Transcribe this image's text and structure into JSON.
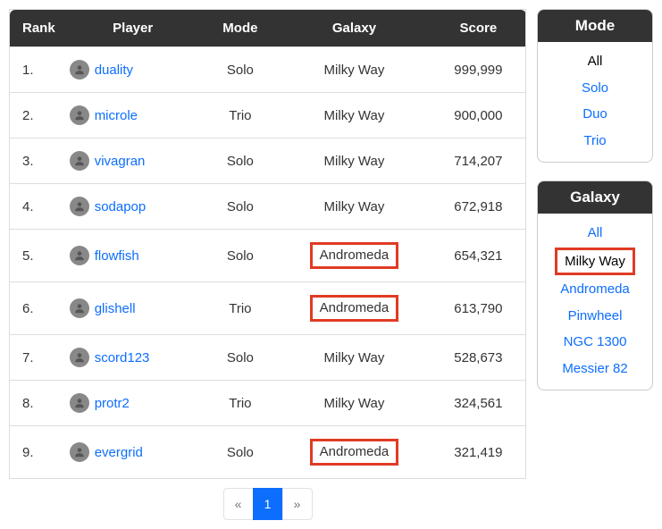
{
  "table": {
    "headers": {
      "rank": "Rank",
      "player": "Player",
      "mode": "Mode",
      "galaxy": "Galaxy",
      "score": "Score"
    },
    "rows": [
      {
        "rank": "1.",
        "player": "duality",
        "mode": "Solo",
        "galaxy": "Milky Way",
        "score": "999,999",
        "galaxy_highlight": false
      },
      {
        "rank": "2.",
        "player": "microle",
        "mode": "Trio",
        "galaxy": "Milky Way",
        "score": "900,000",
        "galaxy_highlight": false
      },
      {
        "rank": "3.",
        "player": "vivagran",
        "mode": "Solo",
        "galaxy": "Milky Way",
        "score": "714,207",
        "galaxy_highlight": false
      },
      {
        "rank": "4.",
        "player": "sodapop",
        "mode": "Solo",
        "galaxy": "Milky Way",
        "score": "672,918",
        "galaxy_highlight": false
      },
      {
        "rank": "5.",
        "player": "flowfish",
        "mode": "Solo",
        "galaxy": "Andromeda",
        "score": "654,321",
        "galaxy_highlight": true
      },
      {
        "rank": "6.",
        "player": "glishell",
        "mode": "Trio",
        "galaxy": "Andromeda",
        "score": "613,790",
        "galaxy_highlight": true
      },
      {
        "rank": "7.",
        "player": "scord123",
        "mode": "Solo",
        "galaxy": "Milky Way",
        "score": "528,673",
        "galaxy_highlight": false
      },
      {
        "rank": "8.",
        "player": "protr2",
        "mode": "Trio",
        "galaxy": "Milky Way",
        "score": "324,561",
        "galaxy_highlight": false
      },
      {
        "rank": "9.",
        "player": "evergrid",
        "mode": "Solo",
        "galaxy": "Andromeda",
        "score": "321,419",
        "galaxy_highlight": true
      }
    ]
  },
  "pagination": {
    "prev": "«",
    "next": "»",
    "pages": [
      "1"
    ],
    "active": "1"
  },
  "filters": {
    "mode": {
      "title": "Mode",
      "items": [
        {
          "label": "All",
          "active": true,
          "boxed": false
        },
        {
          "label": "Solo",
          "active": false,
          "boxed": false
        },
        {
          "label": "Duo",
          "active": false,
          "boxed": false
        },
        {
          "label": "Trio",
          "active": false,
          "boxed": false
        }
      ]
    },
    "galaxy": {
      "title": "Galaxy",
      "items": [
        {
          "label": "All",
          "active": false,
          "boxed": false
        },
        {
          "label": "Milky Way",
          "active": true,
          "boxed": true
        },
        {
          "label": "Andromeda",
          "active": false,
          "boxed": false
        },
        {
          "label": "Pinwheel",
          "active": false,
          "boxed": false
        },
        {
          "label": "NGC 1300",
          "active": false,
          "boxed": false
        },
        {
          "label": "Messier 82",
          "active": false,
          "boxed": false
        }
      ]
    }
  }
}
